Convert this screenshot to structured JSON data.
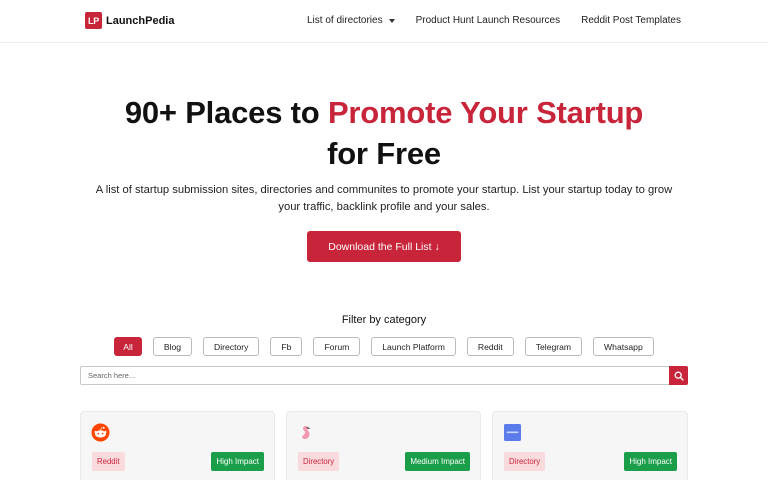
{
  "brand": {
    "mark": "LP",
    "name": "LaunchPedia",
    "color": "#c8243a"
  },
  "nav": {
    "directories": "List of directories",
    "resources": "Product Hunt Launch Resources",
    "templates": "Reddit Post Templates"
  },
  "hero": {
    "title_part1": "90+ Places to ",
    "title_accent": "Promote Your Startup",
    "title_part2": "for Free",
    "subtitle": "A list of startup submission sites, directories and communites to promote your startup. List your startup today to grow your traffic, backlink profile and your sales.",
    "cta": "Download the Full List ↓"
  },
  "filter": {
    "label": "Filter by category",
    "chips": [
      "All",
      "Blog",
      "Directory",
      "Fb",
      "Forum",
      "Launch Platform",
      "Reddit",
      "Telegram",
      "Whatsapp"
    ],
    "active": "All"
  },
  "search": {
    "placeholder": "Search here..."
  },
  "cards": [
    {
      "icon": "reddit-logo-icon",
      "category": "Reddit",
      "impact": "High Impact"
    },
    {
      "icon": "flamingo-logo-icon",
      "category": "Directory",
      "impact": "Medium Impact"
    },
    {
      "icon": "blue-square-logo-icon",
      "category": "Directory",
      "impact": "High Impact"
    }
  ],
  "colors": {
    "accent": "#c8243a",
    "impact_green": "#1a9e4a",
    "tag_bg": "#f9dadd"
  }
}
